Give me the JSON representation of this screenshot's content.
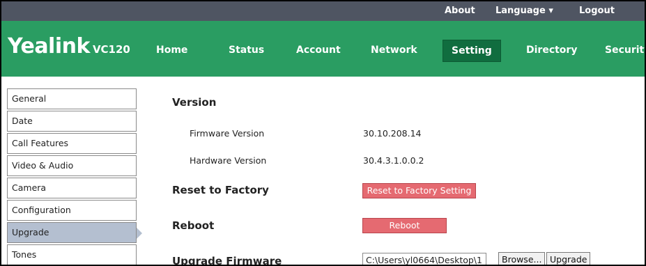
{
  "topbar": {
    "about": "About",
    "language": "Language",
    "language_caret": "▾",
    "logout": "Logout"
  },
  "brand": {
    "name": "Yealink",
    "model": "VC120"
  },
  "nav": {
    "items": [
      "Home",
      "Status",
      "Account",
      "Network",
      "Setting",
      "Directory",
      "Security"
    ],
    "active": "Setting"
  },
  "sidebar": {
    "items": [
      "General",
      "Date",
      "Call Features",
      "Video & Audio",
      "Camera",
      "Configuration",
      "Upgrade",
      "Tones"
    ],
    "active": "Upgrade"
  },
  "main": {
    "version_title": "Version",
    "firmware_label": "Firmware Version",
    "firmware_value": "30.10.208.14",
    "hardware_label": "Hardware Version",
    "hardware_value": "30.4.3.1.0.0.2",
    "reset_title": "Reset to Factory",
    "reset_button": "Reset to Factory Setting",
    "reboot_title": "Reboot",
    "reboot_button": "Reboot",
    "upgrade_title": "Upgrade Firmware",
    "file_path": "C:\\Users\\yl0664\\Desktop\\1",
    "browse_button": "Browse...",
    "upgrade_button": "Upgrade"
  },
  "colors": {
    "topbar": "#4f5562",
    "nav_green": "#2a9d62",
    "nav_active": "#106d3f",
    "sidebar_active": "#b4bfd0",
    "red_button": "#e56a71"
  }
}
